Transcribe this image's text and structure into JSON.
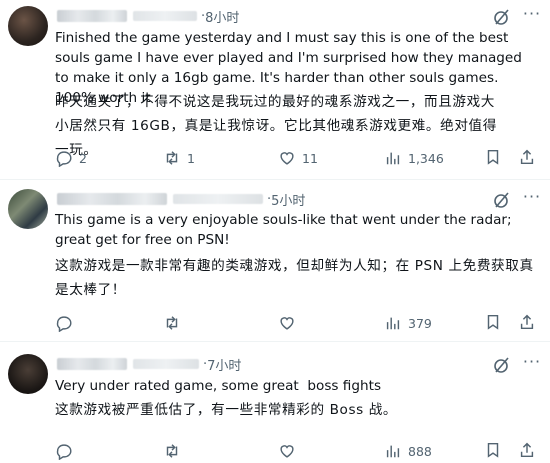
{
  "posts": [
    {
      "time": "8小时",
      "text_en": "Finished the game yesterday and I must say this is one of the best souls game I have ever played and I'm surprised how they managed to make it only a 16gb game. It's harder than other souls games. 100% worth it",
      "text_cn": "昨天通关了，不得不说这是我玩过的最好的魂系游戏之一，而且游戏大小居然只有 16GB，真是让我惊讶。它比其他魂系游戏更难。绝对值得一玩。",
      "replies": "2",
      "reposts": "1",
      "likes": "11",
      "views": "1,346"
    },
    {
      "time": "5小时",
      "text_en": "This game is a very enjoyable souls-like that went under the radar; great get for free on PSN!",
      "text_cn": "这款游戏是一款非常有趣的类魂游戏，但却鲜为人知；在 PSN 上免费获取真是太棒了！",
      "replies": "",
      "reposts": "",
      "likes": "",
      "views": "379"
    },
    {
      "time": "7小时",
      "text_en": "Very under rated game, some great  boss fights",
      "text_cn": "这款游戏被严重低估了，有一些非常精彩的 Boss 战。",
      "replies": "",
      "reposts": "",
      "likes": "",
      "views": "888"
    }
  ],
  "icons": {
    "reply": "reply-icon",
    "repost": "repost-icon",
    "like": "like-icon",
    "views": "views-icon",
    "bookmark": "bookmark-icon",
    "share": "share-icon",
    "grok": "grok-icon",
    "more": "more-icon"
  },
  "colors": {
    "text": "#0f1419",
    "muted": "#536471",
    "divider": "#eff3f4"
  }
}
